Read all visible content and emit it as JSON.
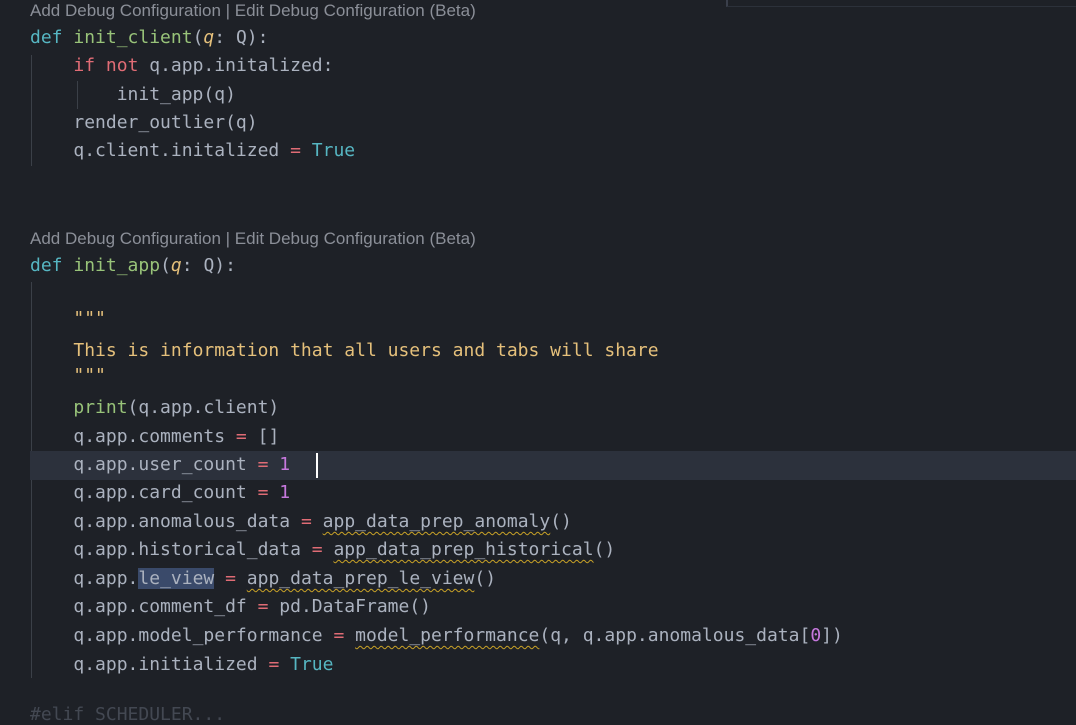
{
  "codelens": {
    "block1": "Add Debug Configuration | Edit Debug Configuration (Beta)",
    "block2": "Add Debug Configuration | Edit Debug Configuration (Beta)"
  },
  "code": {
    "def_kw": "def",
    "init_client_name": "init_client",
    "param_q": "q",
    "type_Q": "Q",
    "if_kw": "if",
    "not_kw": "not",
    "cond": "q.app.initalized",
    "call_init_app": "init_app(q)",
    "render_outlier": "render_outlier(q)",
    "client_init_lhs": "q.client.initalized",
    "eq": "=",
    "true_kw": "True",
    "init_app_name": "init_app",
    "doc_open": "\"\"\"",
    "doc_text": "This is information that all users and tabs will share",
    "doc_close": "\"\"\"",
    "print_kw": "print",
    "print_arg": "(q.app.client)",
    "comments_lhs": "q.app.comments",
    "comments_rhs": "[]",
    "user_count_lhs": "q.app.user_count",
    "one": "1",
    "card_count_lhs": "q.app.card_count",
    "anomalous_lhs": "q.app.anomalous_data",
    "anomalous_fn": "app_data_prep_anomaly",
    "parens": "()",
    "historical_lhs": "q.app.historical_data",
    "historical_fn": "app_data_prep_historical",
    "le_view_prefix": "q.app.",
    "le_view_attr": "le_view",
    "le_view_fn": "app_data_prep_le_view",
    "comment_df_lhs": "q.app.comment_df",
    "comment_df_rhs": "pd.DataFrame()",
    "model_perf_lhs": "q.app.model_performance",
    "model_perf_fn": "model_performance",
    "model_perf_args_a": "(q, q.app.anomalous_data[",
    "zero": "0",
    "model_perf_args_b": "])",
    "initialized_lhs": "q.app.initialized",
    "cut_line": "#elif SCHEDULER..."
  }
}
